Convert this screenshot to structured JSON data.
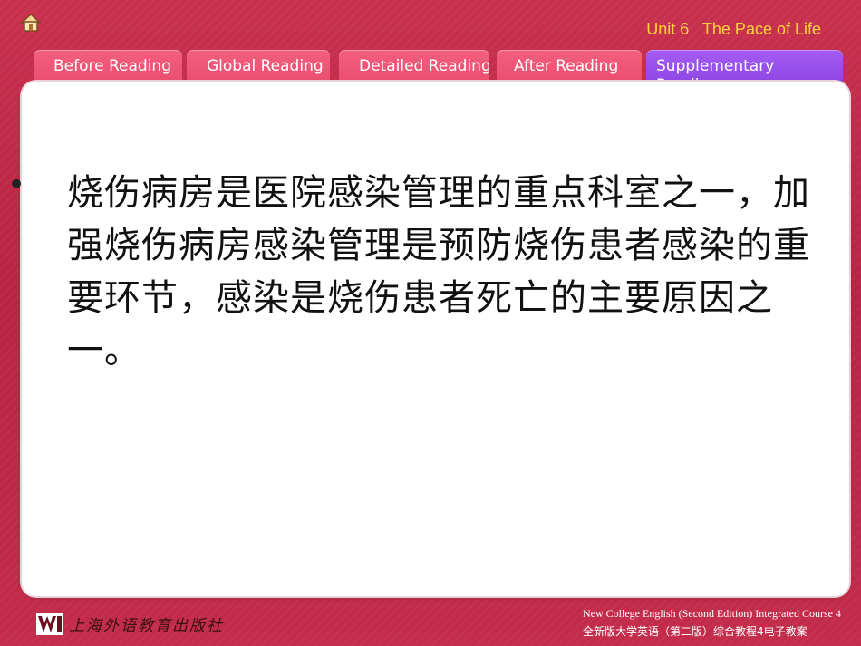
{
  "header": {
    "home_icon": "home-icon",
    "unit_title": "Unit 6   The Pace of Life"
  },
  "tabs": [
    {
      "label": "Before Reading",
      "active": false
    },
    {
      "label": "Global Reading",
      "active": false
    },
    {
      "label": "Detailed Reading",
      "active": false
    },
    {
      "label": "After Reading",
      "active": false
    },
    {
      "label": "Supplementary Reading",
      "active": true
    }
  ],
  "content": {
    "bullet": "•",
    "text": "烧伤病房是医院感染管理的重点科室之一，加强烧伤病房感染管理是预防烧伤患者感染的重要环节，感染是烧伤患者死亡的主要原因之一。"
  },
  "footer": {
    "publisher": "上海外语教育出版社",
    "course_en": "New College English (Second Edition) Integrated Course 4",
    "course_cn": "全新版大学英语（第二版）综合教程4电子教案"
  },
  "colors": {
    "background": "#bf2a48",
    "tab": "#ee5576",
    "tab_active": "#9650ea",
    "unit_title": "#ffd43a"
  }
}
